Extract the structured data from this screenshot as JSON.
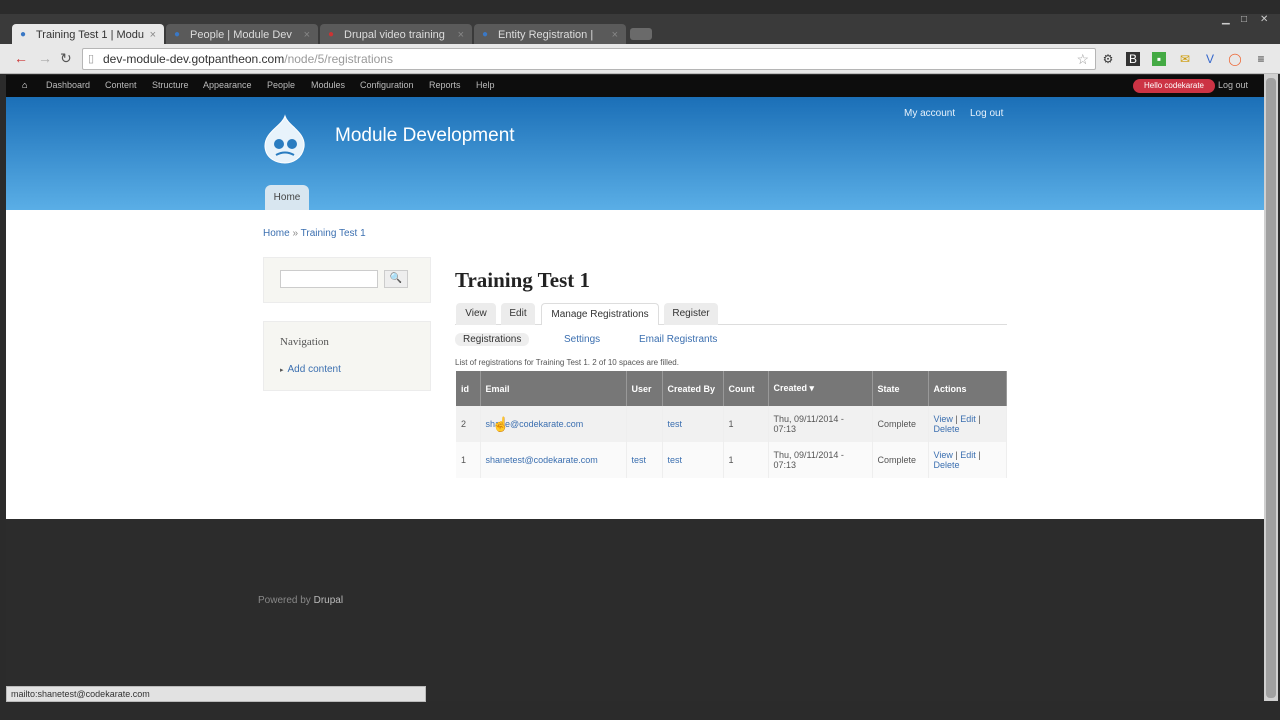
{
  "browser": {
    "tabs": [
      {
        "title": "Training Test 1 | Modu",
        "active": true
      },
      {
        "title": "People | Module Dev",
        "active": false
      },
      {
        "title": "Drupal video training",
        "active": false
      },
      {
        "title": "Entity Registration | ",
        "active": false
      }
    ],
    "url_host": "dev-module-dev.gotpantheon.com",
    "url_path": "/node/5/registrations",
    "status_url": "mailto:shanetest@codekarate.com"
  },
  "admin_bar": {
    "items": [
      "Dashboard",
      "Content",
      "Structure",
      "Appearance",
      "People",
      "Modules",
      "Configuration",
      "Reports",
      "Help"
    ],
    "user": "Hello codekarate",
    "logout": "Log out"
  },
  "site": {
    "name": "Module Development",
    "my_account": "My account",
    "logout": "Log out",
    "home_tab": "Home"
  },
  "breadcrumb": {
    "home": "Home",
    "sep": "»",
    "current": "Training Test 1"
  },
  "sidebar": {
    "search_button": "🔍",
    "nav_title": "Navigation",
    "nav_link": "Add content"
  },
  "main": {
    "title": "Training Test 1",
    "tabs": [
      "View",
      "Edit",
      "Manage Registrations",
      "Register"
    ],
    "subtabs": [
      "Registrations",
      "Settings",
      "Email Registrants"
    ],
    "summary": "List of registrations for Training Test 1. 2 of 10 spaces are filled.",
    "columns": [
      "id",
      "Email",
      "User",
      "Created By",
      "Count",
      "Created ▾",
      "State",
      "Actions"
    ],
    "rows": [
      {
        "id": "2",
        "email": "shane@codekarate.com",
        "user": "",
        "created_by": "test",
        "count": "1",
        "created": "Thu, 09/11/2014 - 07:13",
        "state": "Complete",
        "view": "View",
        "edit": "Edit",
        "delete": "Delete"
      },
      {
        "id": "1",
        "email": "shanetest@codekarate.com",
        "user": "test",
        "created_by": "test",
        "count": "1",
        "created": "Thu, 09/11/2014 - 07:13",
        "state": "Complete",
        "view": "View",
        "edit": "Edit",
        "delete": "Delete"
      }
    ]
  },
  "footer": {
    "powered": "Powered by",
    "drupal": "Drupal"
  },
  "colors": {
    "header_top": "#1b6fb7",
    "header_bottom": "#5aaee6",
    "link": "#3b6fb0",
    "footer": "#2c2c2c"
  }
}
